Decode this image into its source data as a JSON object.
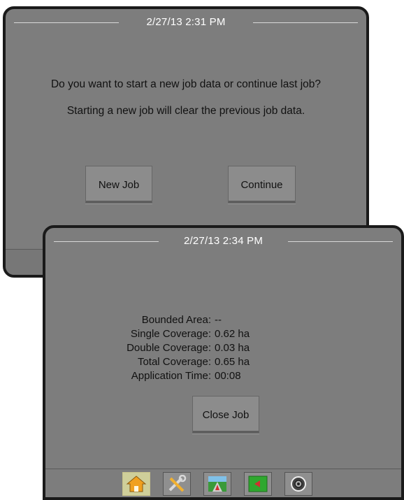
{
  "dialog_new_job": {
    "timestamp": "2/27/13 2:31 PM",
    "question": "Do you want to start a new job data or continue last job?",
    "warning": "Starting a new job will clear the previous job data.",
    "new_job_label": "New Job",
    "continue_label": "Continue"
  },
  "dialog_close_job": {
    "timestamp": "2/27/13 2:34 PM",
    "stats": [
      {
        "label": "Bounded Area:",
        "value": "--"
      },
      {
        "label": "Single Coverage:",
        "value": "0.62 ha"
      },
      {
        "label": "Double Coverage:",
        "value": "0.03 ha"
      },
      {
        "label": "Total Coverage:",
        "value": "0.65 ha"
      },
      {
        "label": "Application Time:",
        "value": "00:08"
      }
    ],
    "close_job_label": "Close Job"
  },
  "tabs": [
    {
      "icon": "home-icon",
      "active": true
    },
    {
      "icon": "tools-icon",
      "active": false
    },
    {
      "icon": "vehicle-view-icon",
      "active": false
    },
    {
      "icon": "field-map-icon",
      "active": false
    },
    {
      "icon": "camera-icon",
      "active": false
    }
  ]
}
